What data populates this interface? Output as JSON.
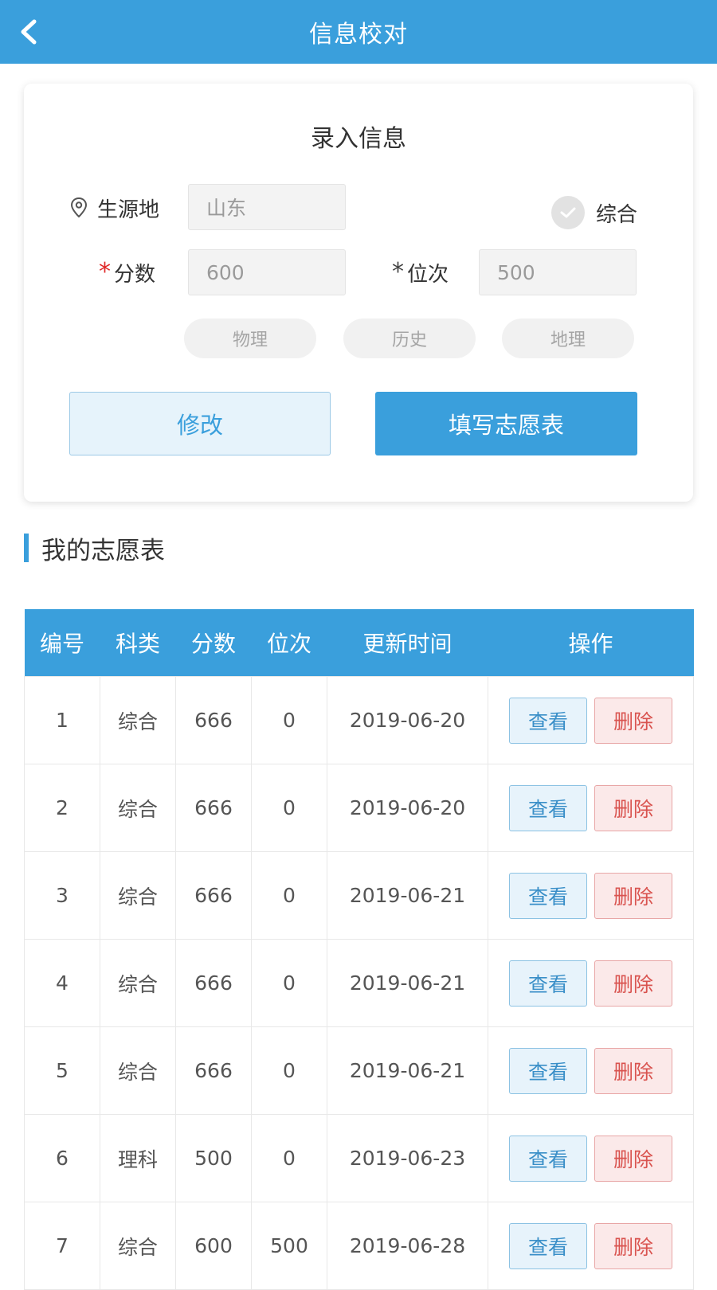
{
  "header": {
    "title": "信息校对",
    "back_icon": "chevron-left-icon"
  },
  "form": {
    "title": "录入信息",
    "origin_label": "生源地",
    "origin_value": "山东",
    "type_option": "综合",
    "score_label": "分数",
    "score_value": "600",
    "rank_label": "位次",
    "rank_value": "500",
    "required_mark": "*",
    "subjects": [
      "物理",
      "历史",
      "地理"
    ],
    "edit_button": "修改",
    "fill_button": "填写志愿表"
  },
  "section": {
    "title": "我的志愿表"
  },
  "table": {
    "headers": [
      "编号",
      "科类",
      "分数",
      "位次",
      "更新时间",
      "操作"
    ],
    "rows": [
      {
        "no": "1",
        "type": "综合",
        "score": "666",
        "rank": "0",
        "time": "2019-06-20"
      },
      {
        "no": "2",
        "type": "综合",
        "score": "666",
        "rank": "0",
        "time": "2019-06-20"
      },
      {
        "no": "3",
        "type": "综合",
        "score": "666",
        "rank": "0",
        "time": "2019-06-21"
      },
      {
        "no": "4",
        "type": "综合",
        "score": "666",
        "rank": "0",
        "time": "2019-06-21"
      },
      {
        "no": "5",
        "type": "综合",
        "score": "666",
        "rank": "0",
        "time": "2019-06-21"
      },
      {
        "no": "6",
        "type": "理科",
        "score": "500",
        "rank": "0",
        "time": "2019-06-23"
      },
      {
        "no": "7",
        "type": "综合",
        "score": "600",
        "rank": "500",
        "time": "2019-06-28"
      }
    ],
    "view_label": "查看",
    "delete_label": "删除"
  },
  "colors": {
    "primary": "#3a9fdc",
    "required_red": "#e02828",
    "delete_red": "#d9534f"
  }
}
